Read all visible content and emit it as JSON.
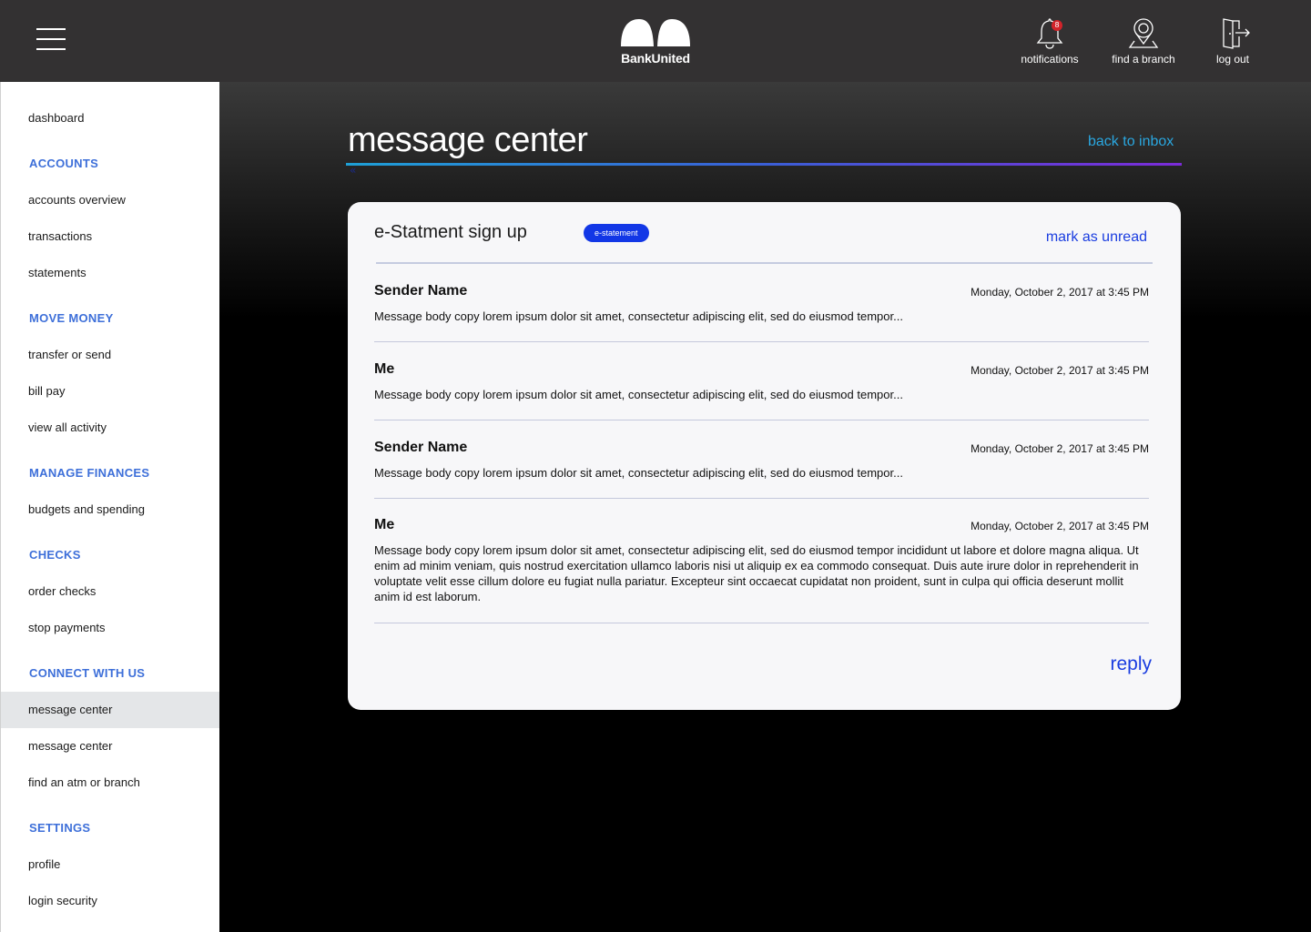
{
  "header": {
    "brand": "BankUnited",
    "notifications": {
      "label": "notifications",
      "count": "8"
    },
    "find_branch": {
      "label": "find a branch"
    },
    "logout": {
      "label": "log out"
    }
  },
  "sidebar": {
    "dashboard": "dashboard",
    "sections": [
      {
        "title": "ACCOUNTS",
        "items": [
          "accounts overview",
          "transactions",
          "statements"
        ]
      },
      {
        "title": "MOVE MONEY",
        "items": [
          "transfer or send",
          "bill pay",
          "view all activity"
        ]
      },
      {
        "title": "MANAGE FINANCES",
        "items": [
          "budgets and spending"
        ]
      },
      {
        "title": "CHECKS",
        "items": [
          "order checks",
          "stop payments"
        ]
      },
      {
        "title": "CONNECT WITH US",
        "items": [
          "message center",
          "message center",
          "find an atm or branch"
        ]
      },
      {
        "title": "SETTINGS",
        "items": [
          "profile",
          "login security"
        ]
      }
    ],
    "active": "message center"
  },
  "main": {
    "title": "message center",
    "back_link": "back to inbox",
    "chevron": "«",
    "card": {
      "subject": "e-Statment sign up",
      "tag": "e-statement",
      "mark_unread": "mark as unread",
      "messages": [
        {
          "sender": "Sender Name",
          "date": "Monday, October 2, 2017 at 3:45 PM",
          "body": "Message body copy lorem ipsum dolor sit amet, consectetur adipiscing elit, sed do eiusmod tempor..."
        },
        {
          "sender": "Me",
          "date": "Monday, October 2, 2017 at 3:45 PM",
          "body": "Message body copy lorem ipsum dolor sit amet, consectetur adipiscing elit, sed do eiusmod tempor..."
        },
        {
          "sender": "Sender Name",
          "date": "Monday, October 2, 2017 at 3:45 PM",
          "body": "Message body copy lorem ipsum dolor sit amet, consectetur adipiscing elit, sed do eiusmod tempor..."
        },
        {
          "sender": "Me",
          "date": "Monday, October 2, 2017 at 3:45 PM",
          "body": "Message body copy lorem ipsum dolor sit amet, consectetur adipiscing elit, sed do eiusmod tempor incididunt ut labore et dolore magna aliqua. Ut enim ad minim veniam, quis nostrud exercitation ullamco laboris nisi ut aliquip ex ea commodo consequat. Duis aute irure dolor in reprehenderit in voluptate velit esse cillum dolore eu fugiat nulla pariatur. Excepteur sint occaecat cupidatat non proident, sunt in culpa qui officia deserunt mollit anim id est laborum."
        }
      ],
      "reply": "reply"
    }
  },
  "colors": {
    "topbar": "#333132",
    "accent_link": "#2aa7e0",
    "primary_blue": "#1a3de0",
    "section_blue": "#3d6fd9",
    "badge_red": "#d2232a"
  }
}
